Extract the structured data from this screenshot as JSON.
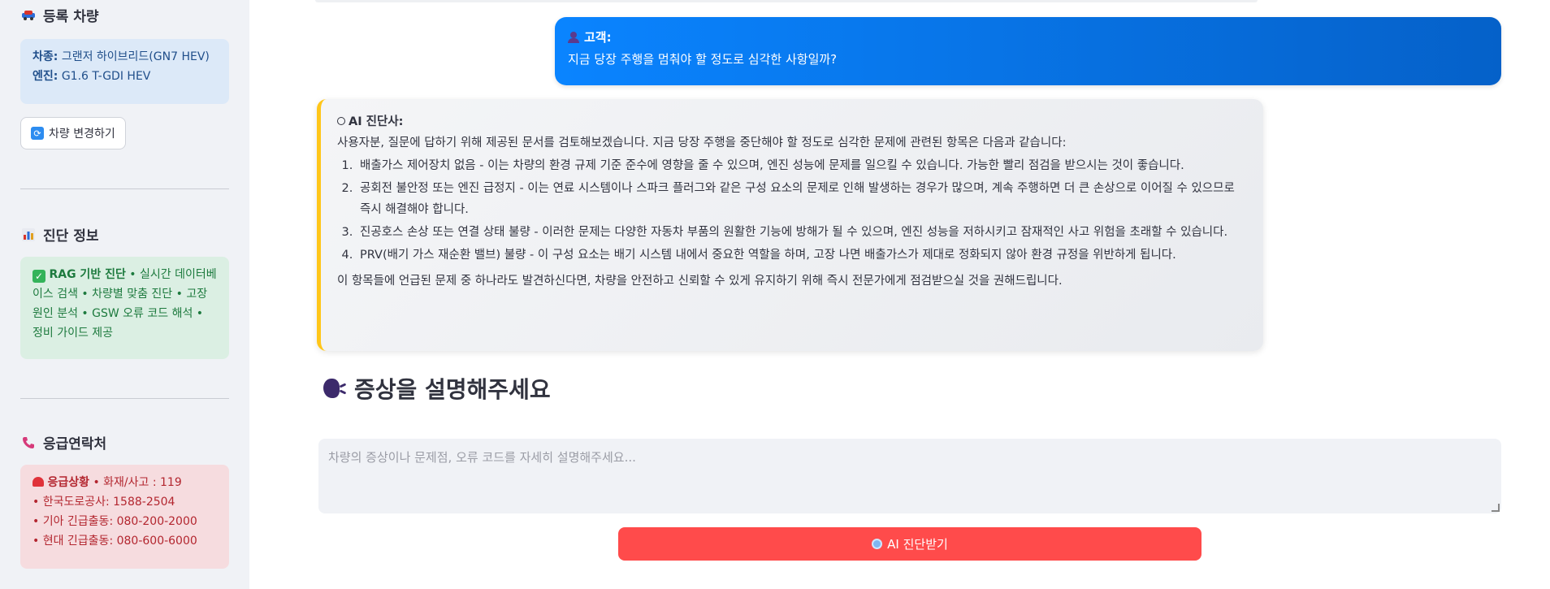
{
  "sidebar": {
    "vehicle_section": {
      "icon": "car-icon",
      "title": "등록 차량",
      "model_label": "차종:",
      "model_value": "그랜저 하이브리드(GN7 HEV)",
      "engine_label": "엔진:",
      "engine_value": "G1.6 T-GDI HEV",
      "change_button": "차량 변경하기"
    },
    "diag_section": {
      "icon": "bar-chart-icon",
      "title": "진단 정보",
      "badge": "RAG 기반 진단",
      "features": "• 실시간 데이터베이스 검색 • 차량별 맞춤 진단 • 고장 원인 분석 • GSW 오류 코드 해석 • 정비 가이드 제공"
    },
    "emergency_section": {
      "icon": "phone-icon",
      "title": "응급연락처",
      "badge": "응급상황",
      "line1": "• 화재/사고 : 119",
      "line2": "• 한국도로공사: 1588-2504",
      "line3": "• 기아 긴급출동: 080-200-2000",
      "line4": "• 현대 긴급출동: 080-600-6000"
    }
  },
  "chat": {
    "customer": {
      "label": "고객:",
      "message": "지금 당장 주행을 멈춰야 할 정도로 심각한 사항일까?"
    },
    "ai": {
      "label": "AI 진단사:",
      "intro": "사용자분, 질문에 답하기 위해 제공된 문서를 검토해보겠습니다. 지금 당장 주행을 중단해야 할 정도로 심각한 문제에 관련된 항목은 다음과 같습니다:",
      "items": [
        "배출가스 제어장치 없음 - 이는 차량의 환경 규제 기준 준수에 영향을 줄 수 있으며, 엔진 성능에 문제를 일으킬 수 있습니다. 가능한 빨리 점검을 받으시는 것이 좋습니다.",
        "공회전 불안정 또는 엔진 급정지 - 이는 연료 시스템이나 스파크 플러그와 같은 구성 요소의 문제로 인해 발생하는 경우가 많으며, 계속 주행하면 더 큰 손상으로 이어질 수 있으므로 즉시 해결해야 합니다.",
        "진공호스 손상 또는 연결 상태 불량 - 이러한 문제는 다양한 자동차 부품의 원활한 기능에 방해가 될 수 있으며, 엔진 성능을 저하시키고 잠재적인 사고 위험을 초래할 수 있습니다.",
        "PRV(배기 가스 재순환 밸브) 불량 - 이 구성 요소는 배기 시스템 내에서 중요한 역할을 하며, 고장 나면 배출가스가 제대로 정화되지 않아 환경 규정을 위반하게 됩니다."
      ],
      "closing": "이 항목들에 언급된 문제 중 하나라도 발견하신다면, 차량을 안전하고 신뢰할 수 있게 유지하기 위해 즉시 전문가에게 점검받으실 것을 권해드립니다."
    }
  },
  "symptom": {
    "icon": "speaking-head-icon",
    "title": "증상을 설명해주세요",
    "placeholder": "차량의 증상이나 문제점, 오류 코드를 자세히 설명해주세요...",
    "submit_label": "AI 진단받기"
  },
  "colors": {
    "sidebar_bg": "#f0f2f6",
    "customer_bubble": "#0a84ff",
    "ai_accent": "#ffc61a",
    "submit_button": "#ff4b4b"
  }
}
